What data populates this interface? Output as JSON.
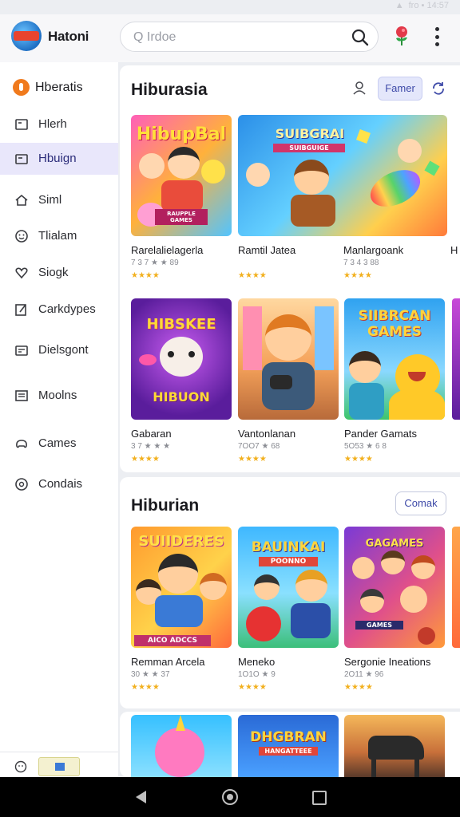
{
  "status": {
    "right_text": "fro ▪ 14:57"
  },
  "appbar": {
    "title": "Hatoni",
    "search_placeholder": "Q Irdoe"
  },
  "sidebar": {
    "header_label": "Hberatis",
    "items": [
      {
        "label": "Hlerh",
        "icon": "inbox-icon",
        "active": false
      },
      {
        "label": "Hbuign",
        "icon": "folder-icon",
        "active": true
      },
      {
        "label": "Siml",
        "icon": "home-icon",
        "active": false
      },
      {
        "label": "Tlialam",
        "icon": "smile-icon",
        "active": false
      },
      {
        "label": "Siogk",
        "icon": "heart-icon",
        "active": false
      },
      {
        "label": "Carkdypes",
        "icon": "edit-icon",
        "active": false
      },
      {
        "label": "Dielsgont",
        "icon": "calendar-icon",
        "active": false
      },
      {
        "label": "Moolns",
        "icon": "list-icon",
        "active": false
      },
      {
        "label": "Cames",
        "icon": "gamepad-icon",
        "active": false
      },
      {
        "label": "Condais",
        "icon": "settings-icon",
        "active": false
      }
    ]
  },
  "section1": {
    "title": "Hiburasia",
    "filter_label": "Famer",
    "tiles": [
      {
        "name": "Rarelalielagerla",
        "meta": "7 3 7 ★ ★ 89",
        "stars": "★★★★",
        "art": "HibupBal",
        "art_sub": "RAUPPLE GAMES"
      },
      {
        "name": "Ramtil Jatea",
        "meta": "",
        "stars": "★★★★",
        "art": "SUIBGRAI",
        "art_sub": "SUIBGUIGE"
      },
      {
        "name": "Manlargoank",
        "meta": "7 3 4 3 88",
        "stars": "★★★★",
        "art": "",
        "art_sub": ""
      },
      {
        "name": "Gabaran",
        "meta": "3 7 ★ ★ ★",
        "stars": "★★★★",
        "art": "HIBSKEE",
        "art_sub": "HIBUON"
      },
      {
        "name": "Vantonlanan",
        "meta": "7OO7 ★ 68",
        "stars": "★★★★",
        "art": "",
        "art_sub": ""
      },
      {
        "name": "Pander Gamats",
        "meta": "5O53 ★ 6 8",
        "stars": "★★★★",
        "art": "SIIBRCAN GAMES",
        "art_sub": ""
      }
    ]
  },
  "section2": {
    "title": "Hiburian",
    "button_label": "Comak",
    "tiles": [
      {
        "name": "Remman Arcela",
        "meta": "30 ★ ★ 37",
        "stars": "★★★★",
        "art": "SUIIDERES",
        "art_sub": "AICO ADCCS"
      },
      {
        "name": "Meneko",
        "meta": "1O1O ★ 9",
        "stars": "★★★★",
        "art": "BAUINKAI",
        "art_sub": "POONNO"
      },
      {
        "name": "Sergonie Ineations",
        "meta": "2O11 ★ 96",
        "stars": "★★★★",
        "art": "GAGAMES",
        "art_sub": "GAMES"
      }
    ]
  },
  "section3": {
    "tiles": [
      {
        "art": ""
      },
      {
        "art": "DHGBRAN",
        "art_sub": "HANGATTEEE"
      },
      {
        "art": ""
      }
    ]
  },
  "colors": {
    "accent": "#3e4aa8",
    "active_bg": "#e9e7fb",
    "star": "#f2b01e"
  }
}
